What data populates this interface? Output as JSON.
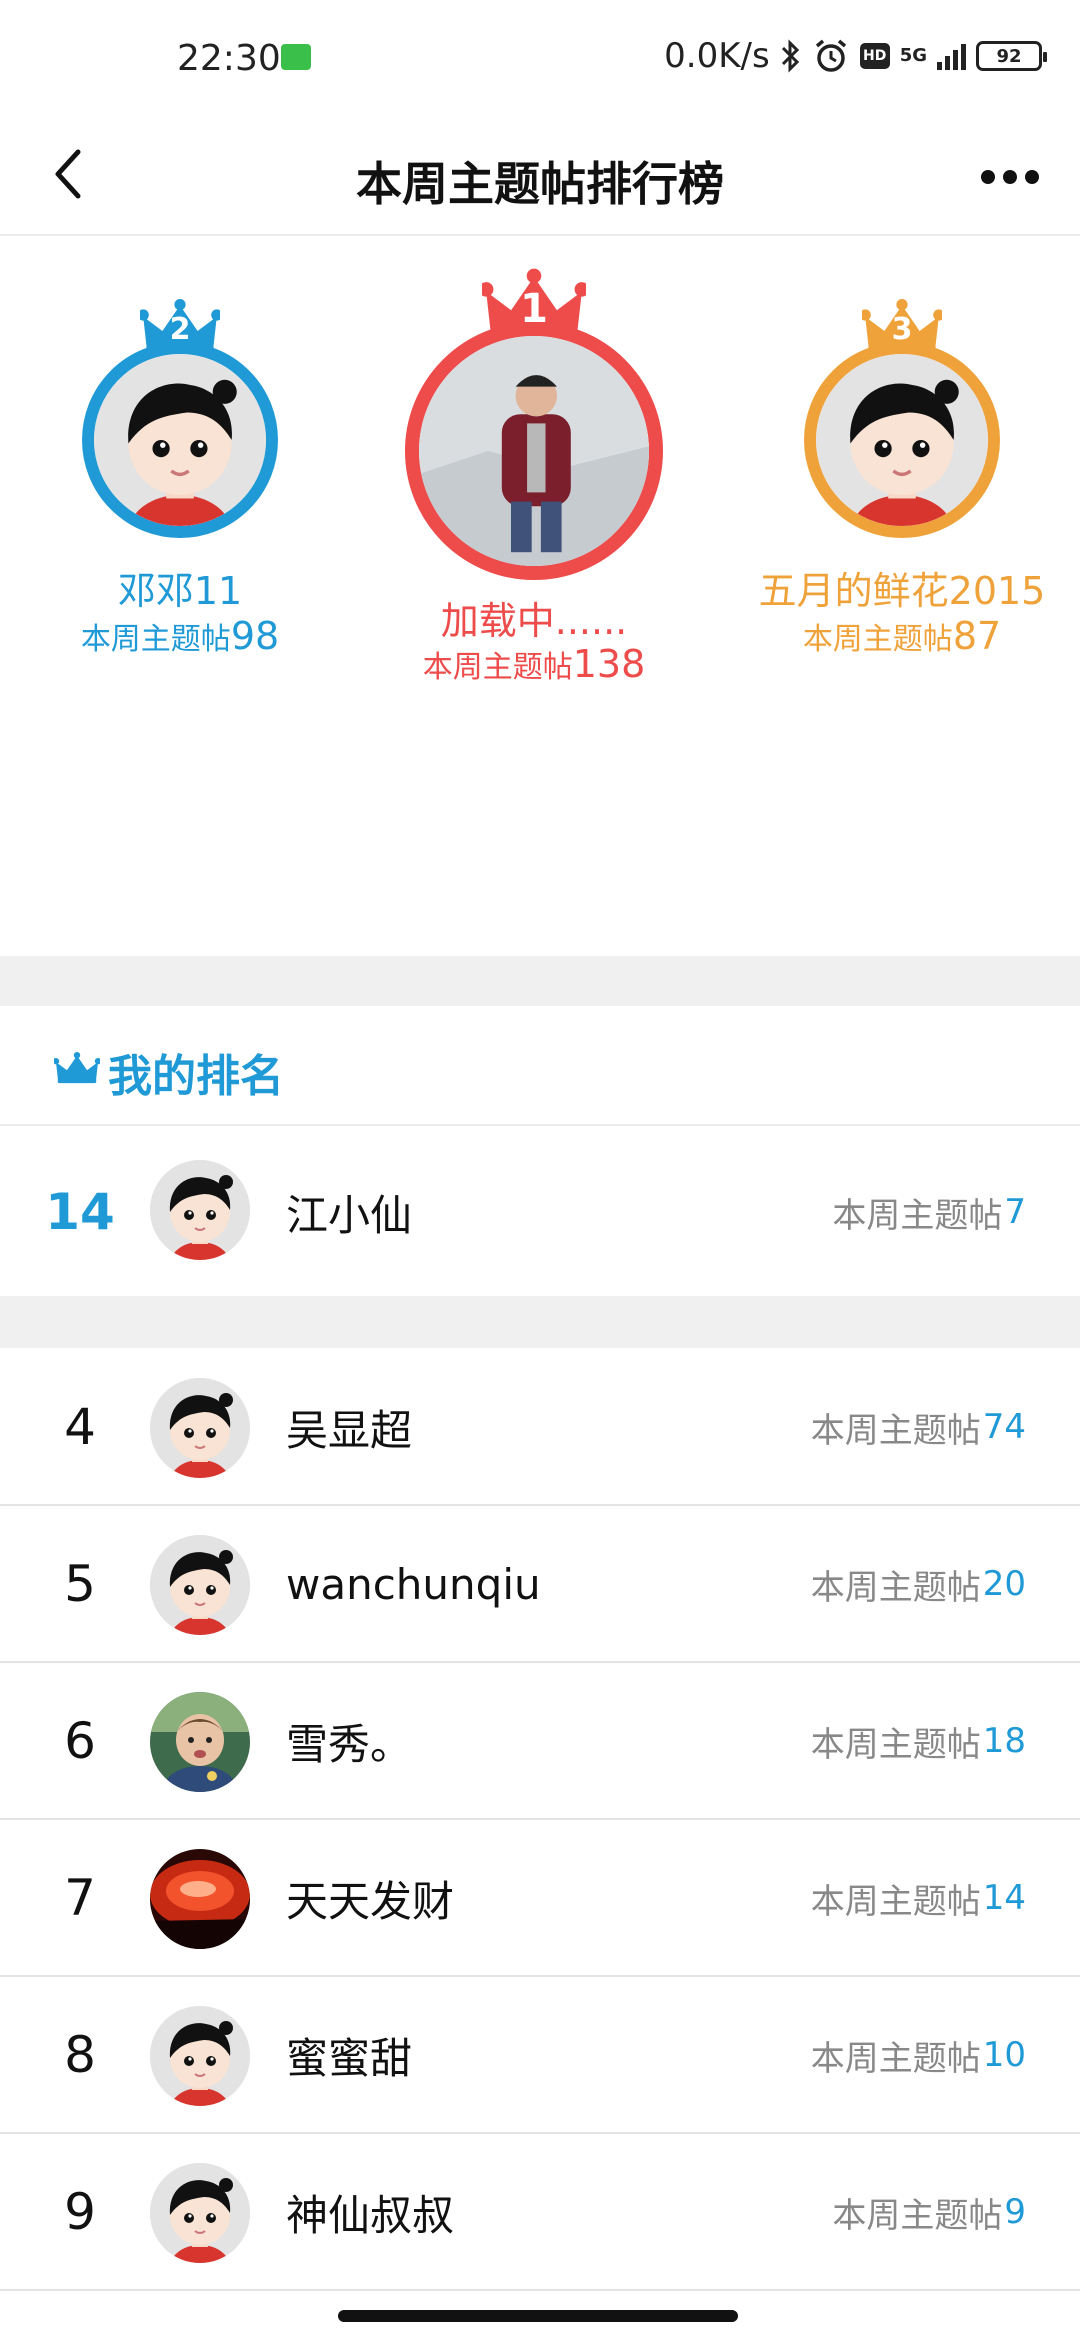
{
  "status_bar": {
    "time": "22:30",
    "speed": "0.0K/s",
    "hd": "HD",
    "network": "5G",
    "battery": "92",
    "icons": [
      "wechat-icon",
      "bluetooth-icon",
      "alarm-icon",
      "hd-icon",
      "signal-icon",
      "battery-icon"
    ]
  },
  "header": {
    "title": "本周主题帖排行榜",
    "back_icon": "chevron-left-icon",
    "more_icon": "more-dots-icon"
  },
  "podium": {
    "first": {
      "rank": "1",
      "name": "加载中......",
      "label": "本周主题帖",
      "count": "138",
      "color": "#ee4b4b"
    },
    "second": {
      "rank": "2",
      "name": "邓邓11",
      "label": "本周主题帖",
      "count": "98",
      "color": "#1f9ad6"
    },
    "third": {
      "rank": "3",
      "name": "五月的鲜花2015",
      "label": "本周主题帖",
      "count": "87",
      "color": "#f0a23a"
    }
  },
  "my_ranking": {
    "title": "我的排名",
    "rank": "14",
    "name": "江小仙",
    "label": "本周主题帖",
    "count": "7"
  },
  "list": [
    {
      "rank": "4",
      "name": "吴显超",
      "label": "本周主题帖",
      "count": "74",
      "avatar": "cartoon"
    },
    {
      "rank": "5",
      "name": "wanchunqiu",
      "label": "本周主题帖",
      "count": "20",
      "avatar": "cartoon"
    },
    {
      "rank": "6",
      "name": "雪秀。",
      "label": "本周主题帖",
      "count": "18",
      "avatar": "photo-child"
    },
    {
      "rank": "7",
      "name": "天天发财",
      "label": "本周主题帖",
      "count": "14",
      "avatar": "photo-red"
    },
    {
      "rank": "8",
      "name": "蜜蜜甜",
      "label": "本周主题帖",
      "count": "10",
      "avatar": "cartoon"
    },
    {
      "rank": "9",
      "name": "神仙叔叔",
      "label": "本周主题帖",
      "count": "9",
      "avatar": "cartoon"
    }
  ],
  "colors": {
    "accent": "#1f9ad6",
    "first": "#ee4b4b",
    "second": "#1f9ad6",
    "third": "#f0a23a"
  }
}
